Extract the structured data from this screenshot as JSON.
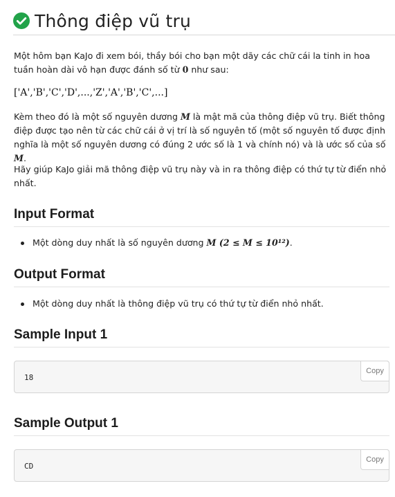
{
  "problem": {
    "title": "Thông điệp vũ trụ",
    "status_color": "#22a34a"
  },
  "statement": {
    "p1_a": "Một hôm bạn KaJo đi xem bói, thầy bói cho bạn một dãy các chữ cái la tinh in hoa tuần hoàn dài vô hạn được đánh số từ ",
    "p1_zero": "0",
    "p1_b": " như sau:",
    "sequence": "['A','B','C','D',...,'Z','A','B','C',...]",
    "p2_a": "Kèm theo đó là một số nguyên dương ",
    "p2_M1": "M",
    "p2_b": " là mật mã của thông điệp vũ trụ. Biết thông điệp được tạo nên từ các chữ cái ở vị trí là số nguyên tố (một số nguyên tố được định nghĩa là một số nguyên dương có đúng 2 ước số là 1 và chính nó) và là ước số của số ",
    "p2_M2": "M",
    "p2_c": ".",
    "p3": "Hãy giúp KaJo giải mã thông điệp vũ trụ này và in ra thông điệp có thứ tự từ điển nhỏ nhất."
  },
  "input_format": {
    "heading": "Input Format",
    "bullet_a": "Một dòng duy nhất là số nguyên dương ",
    "bullet_math": "M (2 ≤ M ≤ 10¹²)",
    "bullet_b": "."
  },
  "output_format": {
    "heading": "Output Format",
    "bullet": "Một dòng duy nhất là thông điệp vũ trụ có thứ tự từ điển nhỏ nhất."
  },
  "samples": [
    {
      "heading": "Sample Input 1",
      "content": "18",
      "copy_label": "Copy"
    },
    {
      "heading": "Sample Output 1",
      "content": "CD",
      "copy_label": "Copy"
    }
  ]
}
